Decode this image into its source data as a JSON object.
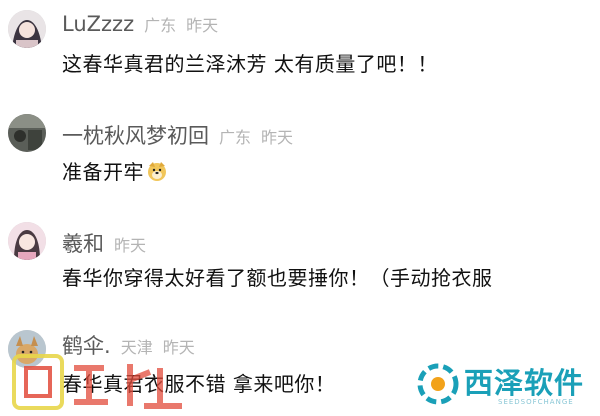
{
  "comments": [
    {
      "username": "LuZzzz",
      "region": "广东",
      "time": "昨天",
      "text": "这春华真君的兰泽沐芳 太有质量了吧！！",
      "avatar_icon": "anime-girl-avatar"
    },
    {
      "username": "一枕秋风梦初回",
      "region": "广东",
      "time": "昨天",
      "text": "准备开牢",
      "emoji": "doge-emoji",
      "avatar_icon": "dark-scene-avatar"
    },
    {
      "username": "羲和",
      "region": "",
      "time": "昨天",
      "text": "春华你穿得太好看了额也要捶你！（手动抢衣服",
      "avatar_icon": "anime-girl-pink-avatar"
    },
    {
      "username": "鹤伞.",
      "region": "天津",
      "time": "昨天",
      "text": "春华真君衣服不错 拿来吧你！",
      "avatar_icon": "dog-avatar"
    }
  ],
  "watermarks": {
    "left_logo": "4399-style-logo",
    "right_brand": "西泽软件",
    "right_sub": "SEEDSOFCHANGE"
  },
  "colors": {
    "username": "#5a5a5a",
    "meta": "#b4b4b4",
    "text": "#111111",
    "watermark_teal": "#1aa0b8"
  }
}
